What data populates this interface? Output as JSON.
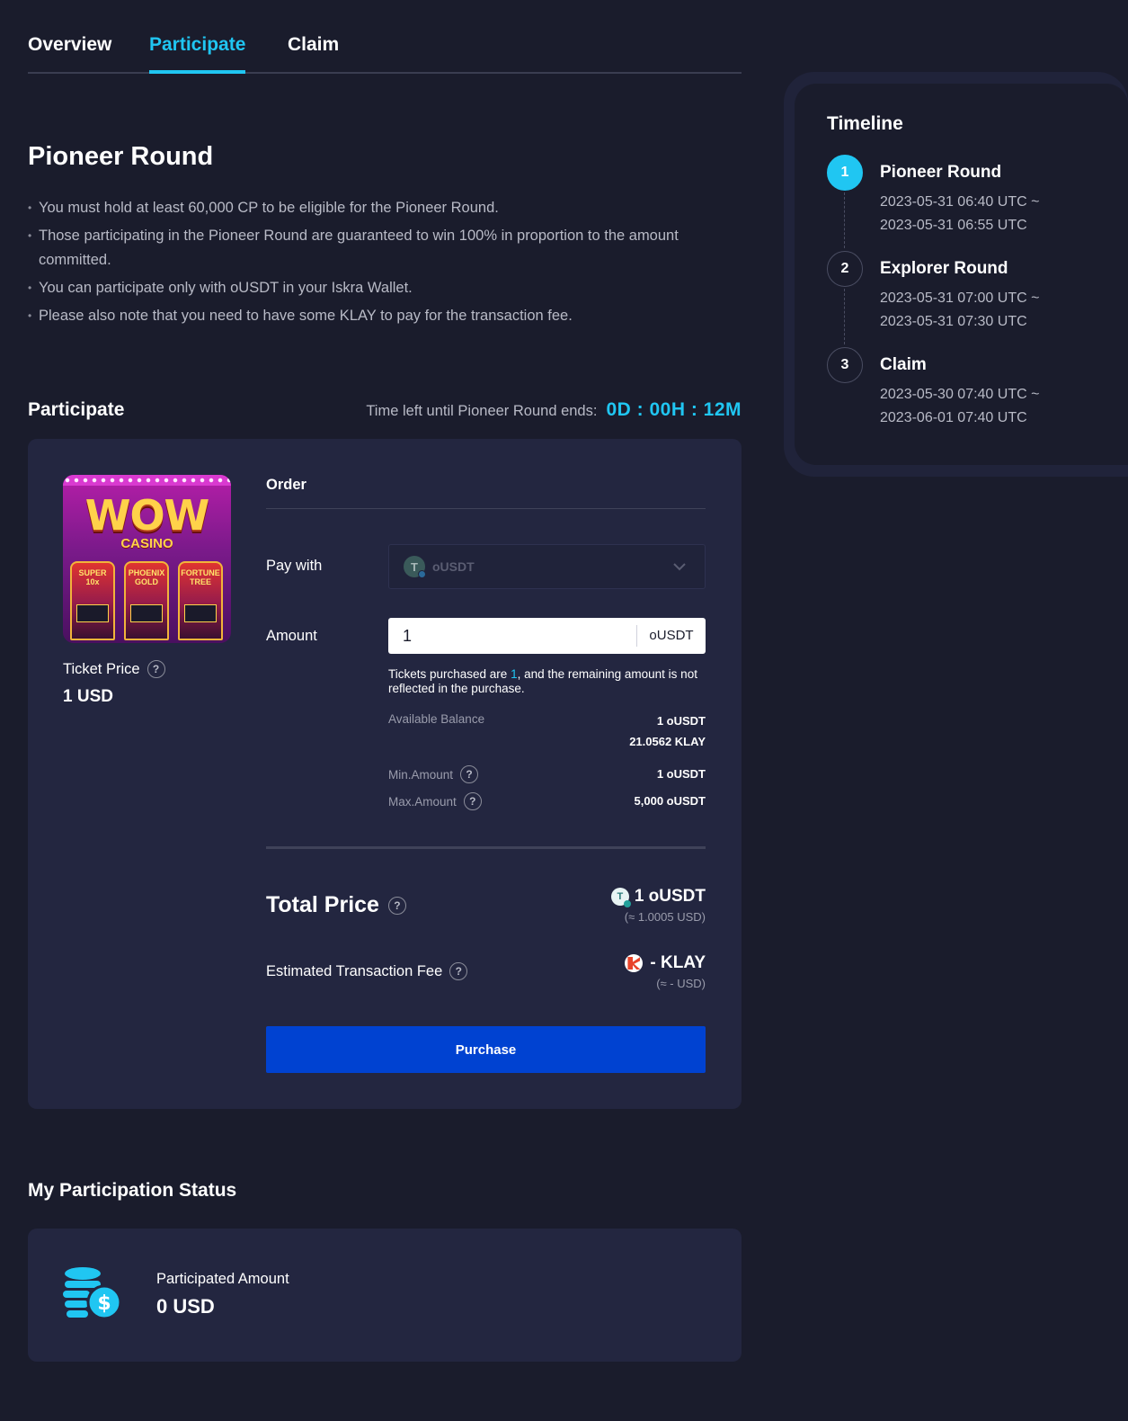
{
  "tabs": [
    {
      "label": "Overview"
    },
    {
      "label": "Participate"
    },
    {
      "label": "Claim"
    }
  ],
  "round": {
    "title": "Pioneer Round",
    "rules": [
      "You must hold at least 60,000 CP to be eligible for the Pioneer Round.",
      "Those participating in the Pioneer Round are guaranteed to win 100% in proportion to the amount committed.",
      "You can participate only with oUSDT in your Iskra Wallet.",
      "Please also note that you need to have some KLAY to pay for the transaction fee."
    ]
  },
  "participate": {
    "title": "Participate",
    "time_left_label": "Time left until Pioneer Round ends:",
    "time_left_value": "0D : 00H : 12M",
    "ticket_price_label": "Ticket Price",
    "ticket_price_value": "1 USD",
    "thumb": {
      "title": "WOW",
      "subtitle": "CASINO",
      "slots": [
        "SUPER 10x",
        "PHOENIX GOLD",
        "FORTUNE TREE"
      ]
    },
    "order_title": "Order",
    "pay_with_label": "Pay with",
    "pay_with_token": "oUSDT",
    "amount_label": "Amount",
    "amount_value": "1",
    "amount_unit": "oUSDT",
    "note_prefix": "Tickets purchased are ",
    "note_count": "1",
    "note_suffix": ", and the remaining amount is not reflected in the purchase.",
    "available_balance_label": "Available Balance",
    "balance_ousdt": "1 oUSDT",
    "balance_klay": "21.0562 KLAY",
    "min_label": "Min.Amount",
    "min_value": "1 oUSDT",
    "max_label": "Max.Amount",
    "max_value": "5,000 oUSDT",
    "total_label": "Total Price",
    "total_value": "1 oUSDT",
    "total_usd": "(≈ 1.0005 USD)",
    "fee_label": "Estimated Transaction Fee",
    "fee_value": "- KLAY",
    "fee_usd": "(≈ - USD)",
    "purchase_label": "Purchase"
  },
  "status": {
    "title": "My Participation Status",
    "amount_label": "Participated Amount",
    "amount_value": "0 USD"
  },
  "timeline": {
    "title": "Timeline",
    "steps": [
      {
        "num": "1",
        "name": "Pioneer Round",
        "start": "2023-05-31 06:40 UTC ~",
        "end": "2023-05-31 06:55 UTC"
      },
      {
        "num": "2",
        "name": "Explorer Round",
        "start": "2023-05-31 07:00 UTC ~",
        "end": "2023-05-31 07:30 UTC"
      },
      {
        "num": "3",
        "name": "Claim",
        "start": "2023-05-30 07:40 UTC ~",
        "end": "2023-06-01 07:40 UTC"
      }
    ]
  },
  "colors": {
    "background": "#1a1c2c",
    "card": "#232640",
    "accent": "#20c6f2",
    "button": "#0042d1"
  }
}
